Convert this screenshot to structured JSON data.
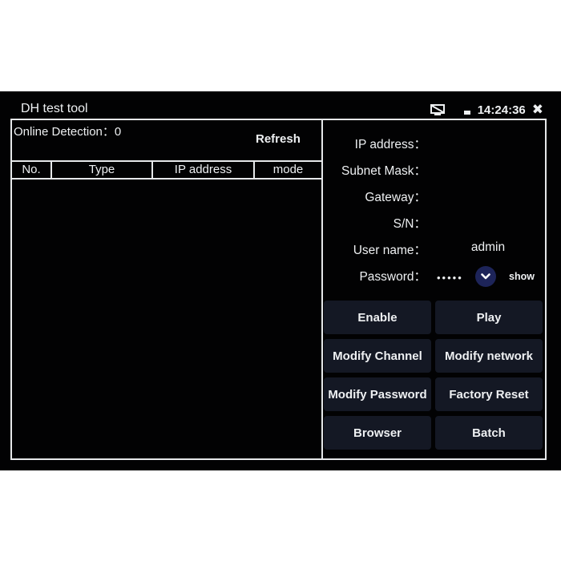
{
  "header": {
    "title": "DH test tool",
    "time": "14:24:36",
    "icons": {
      "display": "no-display-icon",
      "battery": "battery-icon",
      "close": "close-icon"
    },
    "close_glyph": "✖"
  },
  "left": {
    "online_label": "Online Detection：",
    "online_count": "0",
    "refresh_label": "Refresh",
    "columns": [
      "No.",
      "Type",
      "IP address",
      "mode"
    ],
    "rows": []
  },
  "right": {
    "fields": [
      {
        "label": "IP address：",
        "value": ""
      },
      {
        "label": "Subnet Mask：",
        "value": ""
      },
      {
        "label": "Gateway：",
        "value": ""
      },
      {
        "label": "S/N：",
        "value": ""
      },
      {
        "label": "User name：",
        "value": "admin"
      },
      {
        "label": "Password：",
        "value": "•••••"
      }
    ],
    "show_label": "show",
    "buttons": [
      "Enable",
      "Play",
      "Modify Channel",
      "Modify network",
      "Modify Password",
      "Factory Reset",
      "Browser",
      "Batch"
    ]
  },
  "colors": {
    "background": "#020203",
    "border": "#e6e8ea",
    "button_bg": "#141824",
    "dropdown_accent": "#1d2459",
    "text": "#eef0f2"
  }
}
